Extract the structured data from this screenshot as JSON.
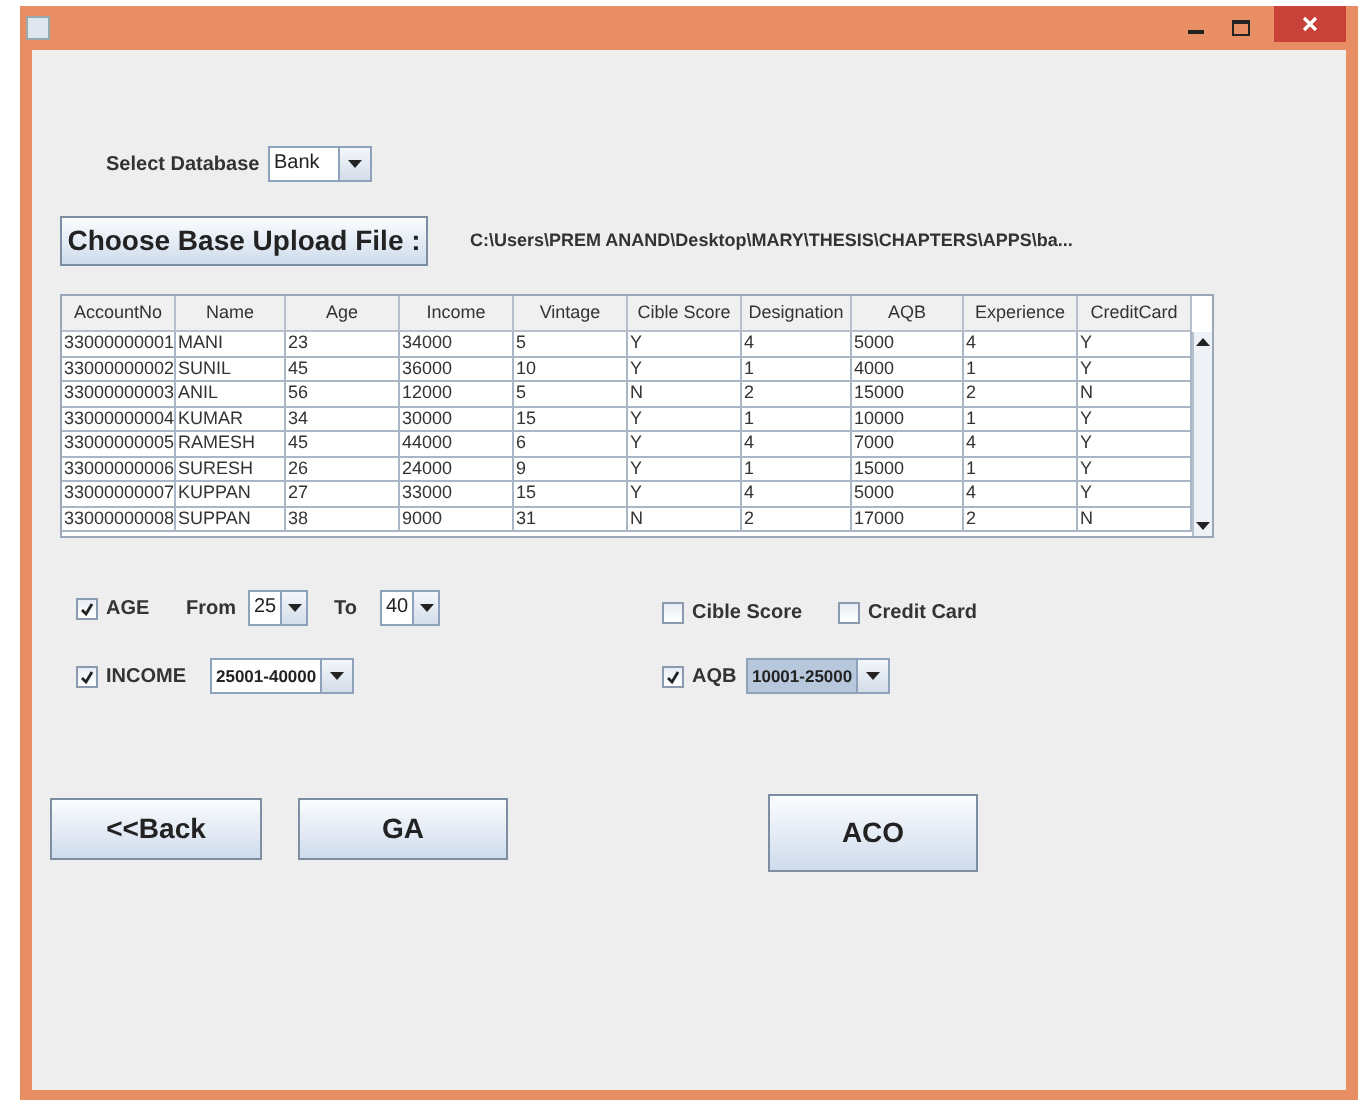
{
  "select_database": {
    "label": "Select Database",
    "value": "Bank"
  },
  "upload": {
    "button": "Choose Base Upload File :",
    "path": "C:\\Users\\PREM ANAND\\Desktop\\MARY\\THESIS\\CHAPTERS\\APPS\\ba..."
  },
  "table": {
    "columns": [
      "AccountNo",
      "Name",
      "Age",
      "Income",
      "Vintage",
      "Cible Score",
      "Designation",
      "AQB",
      "Experience",
      "CreditCard"
    ],
    "rows": [
      [
        "33000000001",
        "MANI",
        "23",
        "34000",
        "5",
        "Y",
        "4",
        "5000",
        "4",
        "Y"
      ],
      [
        "33000000002",
        "SUNIL",
        "45",
        "36000",
        "10",
        "Y",
        "1",
        "4000",
        "1",
        "Y"
      ],
      [
        "33000000003",
        "ANIL",
        "56",
        "12000",
        "5",
        "N",
        "2",
        "15000",
        "2",
        "N"
      ],
      [
        "33000000004",
        "KUMAR",
        "34",
        "30000",
        "15",
        "Y",
        "1",
        "10000",
        "1",
        "Y"
      ],
      [
        "33000000005",
        "RAMESH",
        "45",
        "44000",
        "6",
        "Y",
        "4",
        "7000",
        "4",
        "Y"
      ],
      [
        "33000000006",
        "SURESH",
        "26",
        "24000",
        "9",
        "Y",
        "1",
        "15000",
        "1",
        "Y"
      ],
      [
        "33000000007",
        "KUPPAN",
        "27",
        "33000",
        "15",
        "Y",
        "4",
        "5000",
        "4",
        "Y"
      ],
      [
        "33000000008",
        "SUPPAN",
        "38",
        "9000",
        "31",
        "N",
        "2",
        "17000",
        "2",
        "N"
      ]
    ]
  },
  "filters": {
    "age": {
      "label": "AGE",
      "checked": true,
      "from_label": "From",
      "from_value": "25",
      "to_label": "To",
      "to_value": "40"
    },
    "income": {
      "label": "INCOME",
      "checked": true,
      "value": "25001-40000",
      "focused": false
    },
    "cible_score": {
      "label": "Cible Score",
      "checked": false
    },
    "credit_card": {
      "label": "Credit Card",
      "checked": false
    },
    "aqb": {
      "label": "AQB",
      "checked": true,
      "value": "10001-25000",
      "focused": true
    }
  },
  "buttons": {
    "back": "<<Back",
    "ga": "GA",
    "aco": "ACO"
  }
}
